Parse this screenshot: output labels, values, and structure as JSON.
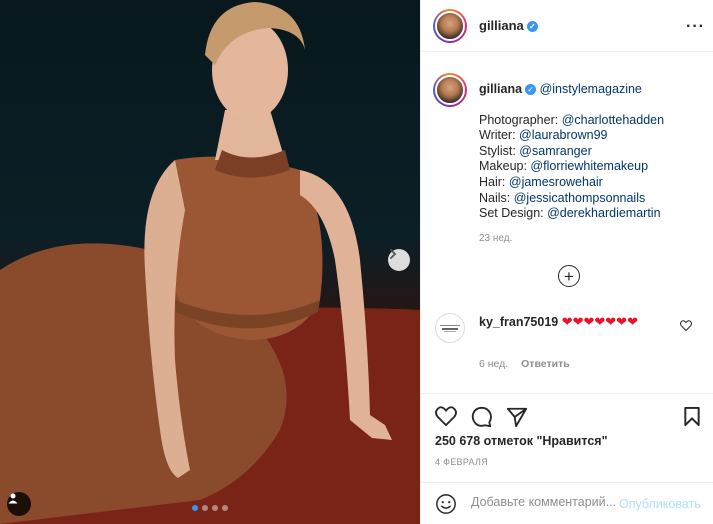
{
  "post": {
    "image_alt": "photo",
    "carousel": {
      "count": 4,
      "active_index": 0
    }
  },
  "header": {
    "username": "gilliana",
    "verified": true,
    "more_icon": "ellipsis-icon"
  },
  "caption": {
    "username": "gilliana",
    "tag": "@instylemagazine",
    "lines": [
      {
        "label": "Photographer: ",
        "mention": "@charlottehadden"
      },
      {
        "label": "Writer: ",
        "mention": "@laurabrown99"
      },
      {
        "label": "Stylist: ",
        "mention": "@samranger"
      },
      {
        "label": "Makeup: ",
        "mention": "@florriewhitemakeup"
      },
      {
        "label": "Hair: ",
        "mention": "@jamesrowehair"
      },
      {
        "label": "Nails: ",
        "mention": "@jessicathompsonnails"
      },
      {
        "label": "Set Design: ",
        "mention": "@derekhardiemartin"
      }
    ],
    "time": "23 нед."
  },
  "comments": [
    {
      "username": "ky_fran75019",
      "text": "❤❤❤❤❤❤❤",
      "time": "6 нед.",
      "reply_label": "Ответить"
    }
  ],
  "actions": {
    "likes_text": "250 678 отметок \"Нравится\"",
    "date": "4 ФЕВРАЛЯ"
  },
  "add_comment": {
    "placeholder": "Добавьте комментарий...",
    "publish_label": "Опубликовать"
  },
  "colors": {
    "accent": "#3897f0",
    "link": "#00376b",
    "heart": "#e8132a",
    "muted": "#8e8e8e"
  }
}
